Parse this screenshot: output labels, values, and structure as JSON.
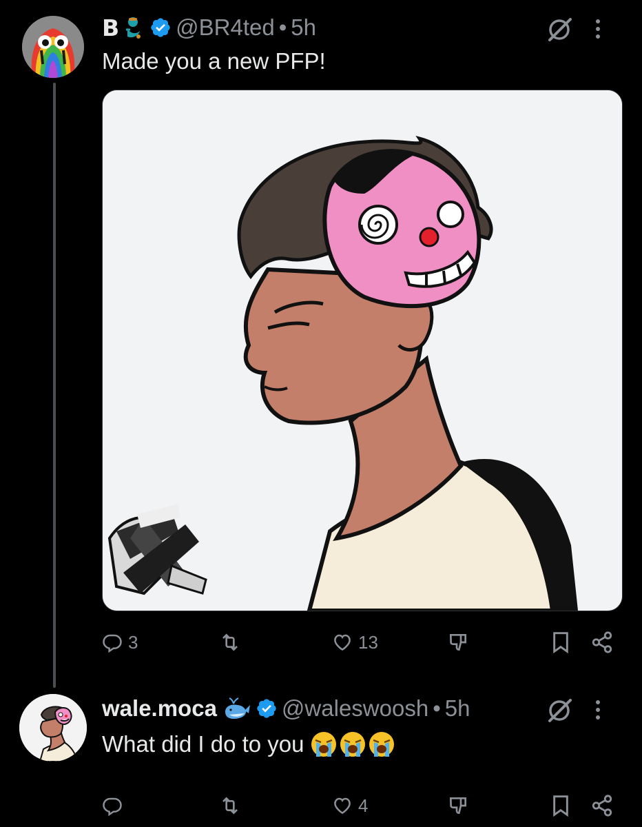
{
  "tweet1": {
    "display_name": "B",
    "name_emoji_icon": "genie-emoji-icon",
    "handle": "@BR4ted",
    "time": "5h",
    "text": "Made you a new PFP!",
    "replies": "3",
    "likes": "13"
  },
  "tweet2": {
    "display_name": "wale.moca",
    "name_emoji_icon": "whale-emoji-icon",
    "handle": "@waleswoosh",
    "time": "5h",
    "text": "What did I do to you",
    "likes": "4"
  },
  "colors": {
    "background": "#000000",
    "text": "#e7e9ea",
    "secondary": "#8b9197",
    "verified": "#1d9bf0",
    "thread_line": "#4a4f54",
    "media_bg": "#f1f3f4",
    "mask_pink": "#ef8fc3"
  }
}
